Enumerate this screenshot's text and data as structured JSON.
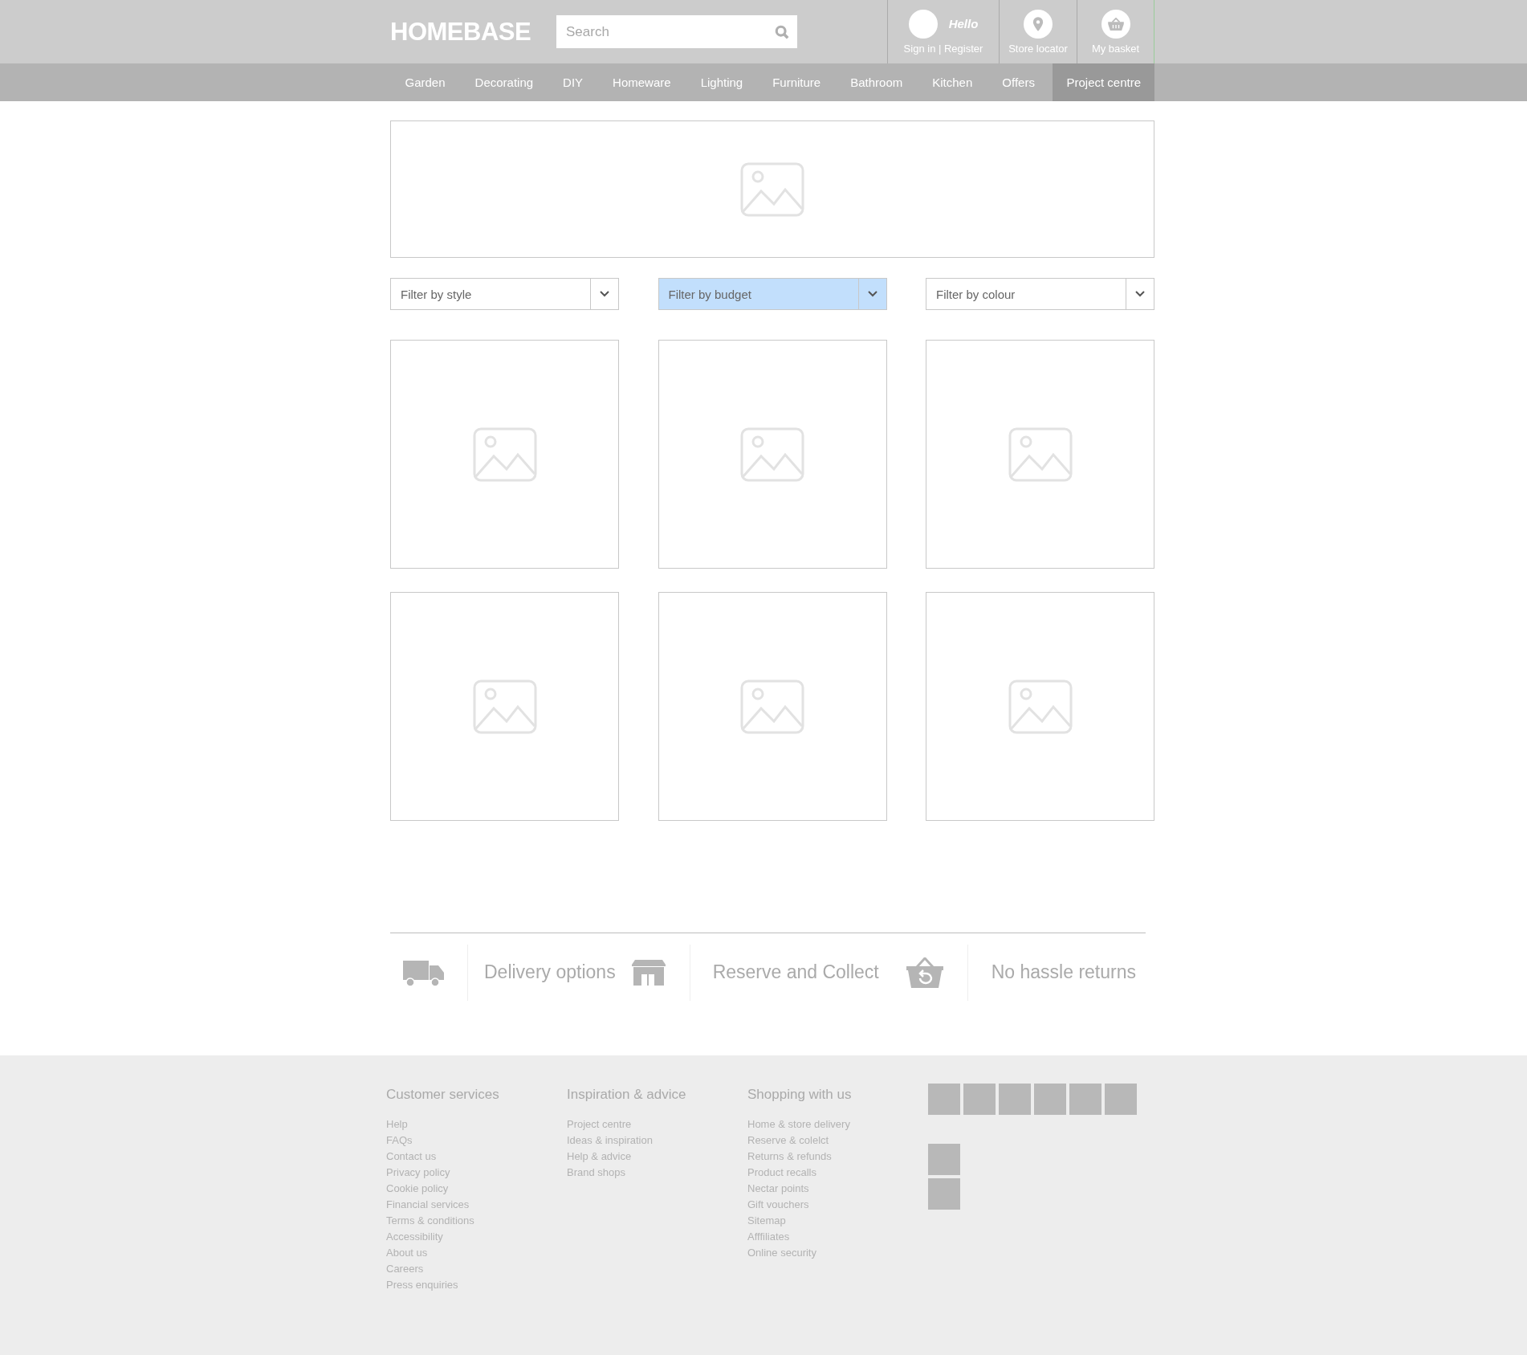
{
  "header": {
    "logo": "HOMEBASE",
    "search": {
      "placeholder": "Search"
    },
    "account": {
      "greeting": "Hello",
      "link": "Sign in | Register"
    },
    "store_locator": "Store locator",
    "basket": "My basket"
  },
  "nav": [
    {
      "label": "Garden",
      "selected": false
    },
    {
      "label": "Decorating",
      "selected": false
    },
    {
      "label": "DIY",
      "selected": false
    },
    {
      "label": "Homeware",
      "selected": false
    },
    {
      "label": "Lighting",
      "selected": false
    },
    {
      "label": "Furniture",
      "selected": false
    },
    {
      "label": "Bathroom",
      "selected": false
    },
    {
      "label": "Kitchen",
      "selected": false
    },
    {
      "label": "Offers",
      "selected": false
    },
    {
      "label": "Project centre",
      "selected": true
    }
  ],
  "hero": {
    "kind": "image-placeholder"
  },
  "filters": [
    {
      "label": "Filter by style",
      "highlighted": false
    },
    {
      "label": "Filter by budget",
      "highlighted": true
    },
    {
      "label": "Filter by colour",
      "highlighted": false
    }
  ],
  "tiles": [
    {
      "kind": "image-placeholder"
    },
    {
      "kind": "image-placeholder"
    },
    {
      "kind": "image-placeholder"
    },
    {
      "kind": "image-placeholder"
    },
    {
      "kind": "image-placeholder"
    },
    {
      "kind": "image-placeholder"
    }
  ],
  "services": [
    {
      "kind": "truck",
      "label": "Delivery options"
    },
    {
      "kind": "store",
      "label": "Reserve and Collect"
    },
    {
      "kind": "basket-return",
      "label": "No hassle returns"
    }
  ],
  "footer": {
    "columns": [
      {
        "heading": "Customer services",
        "links": [
          "Help",
          "FAQs",
          "Contact us",
          "Privacy policy",
          "Cookie policy",
          "Financial services",
          "Terms & conditions",
          "Accessibility",
          "About us",
          "Careers",
          "Press enquiries"
        ]
      },
      {
        "heading": "Inspiration & advice",
        "links": [
          "Project centre",
          "Ideas & inspiration",
          "Help & advice",
          "Brand shops"
        ]
      },
      {
        "heading": "Shopping with us",
        "links": [
          "Home & store delivery",
          "Reserve & colelct",
          "Returns & refunds",
          "Product recalls",
          "Nectar points",
          "Gift vouchers",
          "Sitemap",
          "Afffiliates",
          "Online security"
        ]
      }
    ],
    "logo_rows": [
      [
        {
          "kind": "placeholder"
        },
        {
          "kind": "placeholder"
        },
        {
          "kind": "placeholder"
        },
        {
          "kind": "placeholder"
        },
        {
          "kind": "placeholder"
        },
        {
          "kind": "placeholder"
        }
      ],
      [
        {
          "kind": "placeholder"
        }
      ],
      [
        {
          "kind": "placeholder"
        }
      ]
    ]
  }
}
